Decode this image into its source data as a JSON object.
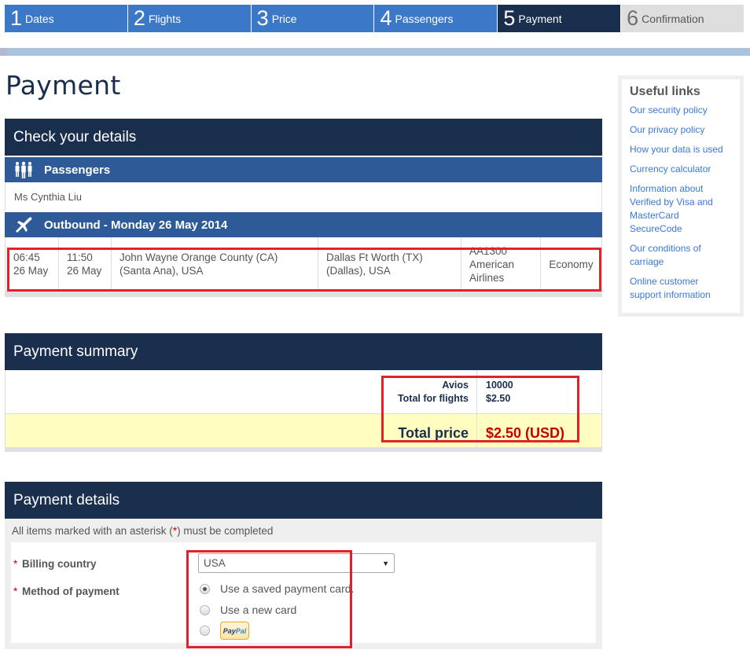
{
  "steps": [
    {
      "num": "1",
      "label": "Dates",
      "state": "done"
    },
    {
      "num": "2",
      "label": "Flights",
      "state": "done"
    },
    {
      "num": "3",
      "label": "Price",
      "state": "done"
    },
    {
      "num": "4",
      "label": "Passengers",
      "state": "done"
    },
    {
      "num": "5",
      "label": "Payment",
      "state": "active"
    },
    {
      "num": "6",
      "label": "Confirmation",
      "state": "future"
    }
  ],
  "page_title": "Payment",
  "check_details": {
    "heading": "Check your details",
    "passengers_heading": "Passengers",
    "passenger_name": "Ms Cynthia Liu",
    "outbound_heading": "Outbound - Monday 26 May 2014",
    "flight": {
      "depart_time": "06:45",
      "depart_date": "26 May",
      "arrive_time": "11:50",
      "arrive_date": "26 May",
      "origin_line1": "John Wayne Orange County (CA)",
      "origin_line2": "(Santa Ana), USA",
      "destination_line1": "Dallas Ft Worth (TX)",
      "destination_line2": "(Dallas), USA",
      "flight_number": "AA1300",
      "airline_line1": "American",
      "airline_line2": "Airlines",
      "cabin": "Economy"
    }
  },
  "payment_summary": {
    "heading": "Payment summary",
    "avios_label": "Avios",
    "avios_value": "10000",
    "flights_label": "Total for flights",
    "flights_value": "$2.50",
    "total_label": "Total price",
    "total_value": "$2.50 (USD)"
  },
  "payment_details": {
    "heading": "Payment details",
    "note_prefix": "All items marked with an asterisk (",
    "note_asterisk": "*",
    "note_suffix": ") must be completed",
    "asterisk": "*",
    "billing_country_label": "Billing country",
    "billing_country_value": "USA",
    "method_label": "Method of payment",
    "methods": [
      {
        "label": "Use a saved payment card.",
        "checked": true
      },
      {
        "label": "Use a new card",
        "checked": false
      },
      {
        "label": "PayPal",
        "checked": false
      }
    ],
    "paypal_pay": "Pay",
    "paypal_pal": "Pal"
  },
  "sidebar": {
    "heading": "Useful links",
    "links": [
      "Our security policy",
      "Our privacy policy",
      "How your data is used",
      "Currency calculator",
      "Information about Verified by Visa and MasterCard SecureCode",
      "Our conditions of carriage",
      "Online customer support information"
    ]
  },
  "colors": {
    "step_done": "#3c78c8",
    "step_active": "#1a2e4d",
    "step_future": "#dedede",
    "panel_header": "#1a2e4d",
    "sub_header": "#2e5b98",
    "highlight_box": "#e3212b",
    "total_price": "#c80000",
    "total_row_bg": "#fffdc0",
    "link": "#3a78d8"
  }
}
